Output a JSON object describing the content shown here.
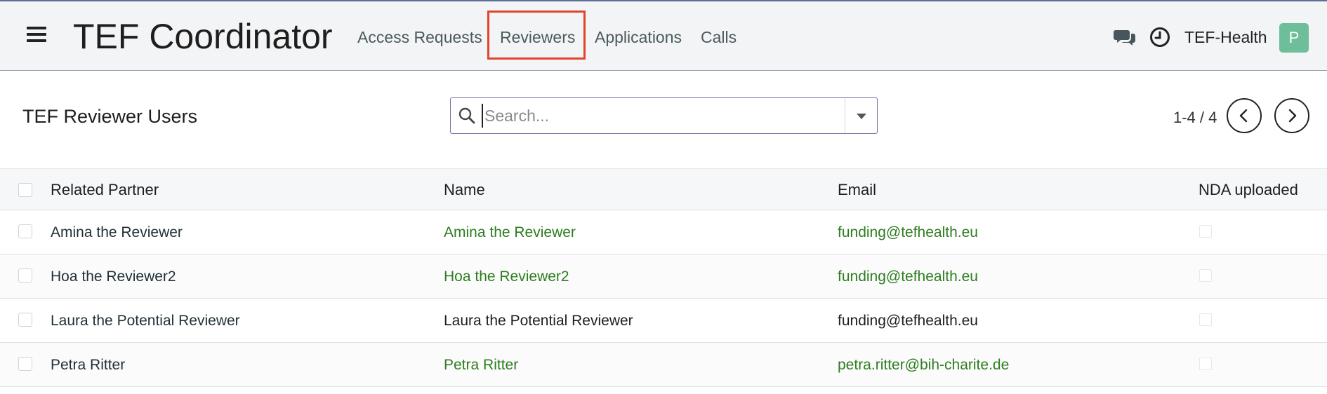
{
  "navbar": {
    "brand": "TEF Coordinator",
    "menu_icon": "hamburger-menu-icon",
    "items": [
      {
        "label": "Access Requests"
      },
      {
        "label": "Reviewers",
        "highlighted": true
      },
      {
        "label": "Applications"
      },
      {
        "label": "Calls"
      }
    ],
    "chat_icon": "chat-bubbles-icon",
    "activity_icon": "clock-icon",
    "company": "TEF-Health",
    "avatar_letter": "P",
    "colors": {
      "highlight": "#e2442f",
      "avatar": "#6fbe9a",
      "link": "#2e7d20"
    }
  },
  "control_panel": {
    "title": "TEF Reviewer Users",
    "search": {
      "placeholder": "Search...",
      "value": ""
    },
    "pager": {
      "value": "1-4 / 4"
    }
  },
  "table": {
    "columns": [
      "Related Partner",
      "Name",
      "Email",
      "NDA uploaded"
    ],
    "rows": [
      {
        "partner": "Amina the Reviewer",
        "name": "Amina the Reviewer",
        "email": "funding@tefhealth.eu",
        "nda_uploaded": false,
        "linked": true
      },
      {
        "partner": "Hoa the Reviewer2",
        "name": "Hoa the Reviewer2",
        "email": "funding@tefhealth.eu",
        "nda_uploaded": false,
        "linked": true
      },
      {
        "partner": "Laura the Potential Reviewer",
        "name": "Laura the Potential Reviewer",
        "email": "funding@tefhealth.eu",
        "nda_uploaded": false,
        "linked": false
      },
      {
        "partner": "Petra Ritter",
        "name": "Petra Ritter",
        "email": "petra.ritter@bih-charite.de",
        "nda_uploaded": false,
        "linked": true
      }
    ]
  }
}
